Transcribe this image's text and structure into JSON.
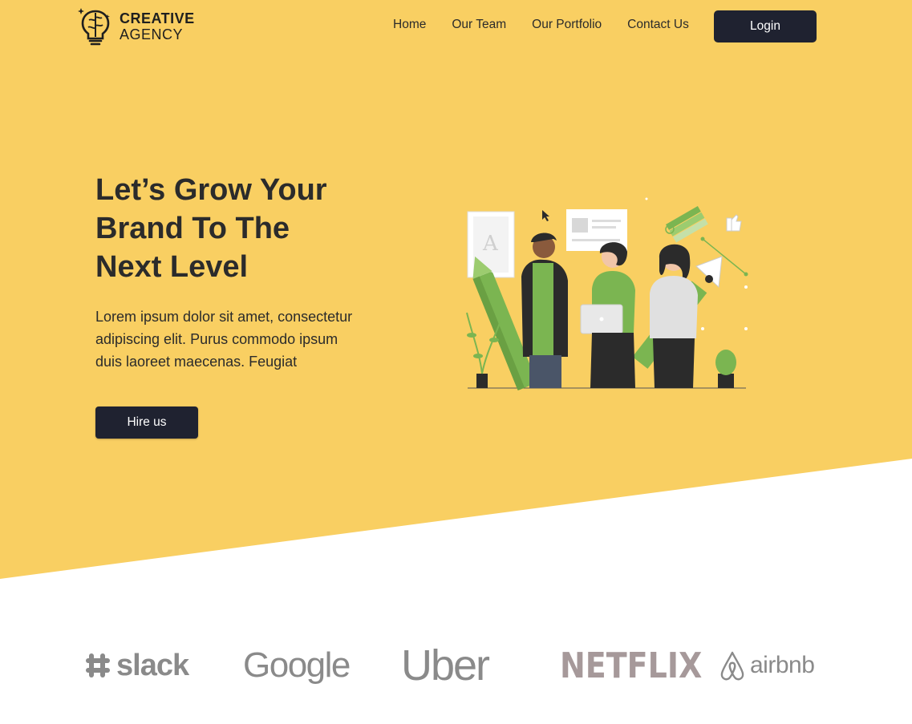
{
  "header": {
    "logo_line1": "CREATIVE",
    "logo_line2": "AGENCY",
    "nav": [
      "Home",
      "Our Team",
      "Our Portfolio",
      "Contact Us"
    ],
    "login_label": "Login"
  },
  "hero": {
    "headline_lines": [
      "Let’s Grow Your",
      "Brand To The",
      "Next Level"
    ],
    "copy_lines": [
      "Lorem ipsum dolor sit amet, consectetur",
      "adipiscing elit. Purus commodo ipsum",
      "duis laoreet maecenas. Feugiat"
    ],
    "cta_label": "Hire us"
  },
  "brands": [
    "slack",
    "Google",
    "Uber",
    "NETFLIX",
    "airbnb"
  ],
  "colors": {
    "hero_background": "#f9cf62",
    "button_dark": "#1f2230",
    "illustration_green": "#7bb551",
    "brand_gray": "#8a8a8a"
  }
}
